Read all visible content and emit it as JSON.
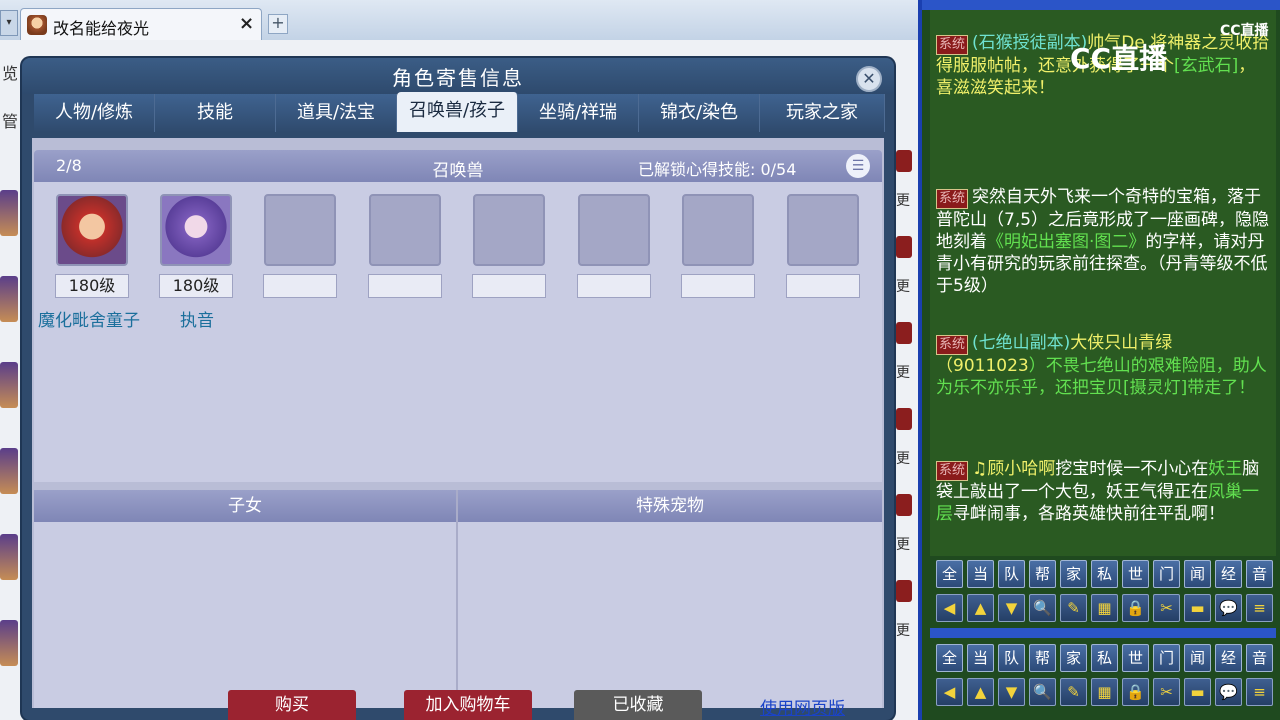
{
  "window": {
    "tab_title": "改名能给夜光",
    "tab_close": "×",
    "tab_add": "+",
    "dropdown": "▾"
  },
  "dialog": {
    "title": "角色寄售信息",
    "close": "✕",
    "tabs": [
      {
        "label": "人物/修炼"
      },
      {
        "label": "技能"
      },
      {
        "label": "道具/法宝"
      },
      {
        "label": "召唤兽/孩子"
      },
      {
        "label": "坐骑/祥瑞"
      },
      {
        "label": "锦衣/染色"
      },
      {
        "label": "玩家之家"
      }
    ],
    "active_tab": "召唤兽/孩子",
    "pets": {
      "count": "2/8",
      "title": "召唤兽",
      "skill_label": "已解锁心得技能: 0/54",
      "slots": [
        {
          "level": "180级",
          "name": "魔化毗舍童子"
        },
        {
          "level": "180级",
          "name": "执音"
        },
        {
          "level": "",
          "name": ""
        },
        {
          "level": "",
          "name": ""
        },
        {
          "level": "",
          "name": ""
        },
        {
          "level": "",
          "name": ""
        },
        {
          "level": "",
          "name": ""
        },
        {
          "level": "",
          "name": ""
        }
      ]
    },
    "children_header": "子女",
    "special_header": "特殊宠物",
    "actions": {
      "buy": "购买",
      "add_cart": "加入购物车",
      "favorited": "已收藏",
      "web_link": "使用网页版"
    },
    "colors": {
      "buy": "#9b2330",
      "cart": "#9b2330",
      "favorited": "#5a5a5a"
    }
  },
  "left_edge": {
    "glyph_1": "览",
    "glyph_2": "管",
    "side_chars": [
      "更",
      "更",
      "更",
      "更",
      "更",
      "更"
    ]
  },
  "chat": {
    "logo": "CC直播",
    "logo_small": "CC直播",
    "messages": [
      {
        "tag": "系统",
        "parts": [
          {
            "text": "(石猴授徒副本)",
            "color": "cyan"
          },
          {
            "text": "帅气De",
            "color": "yellow"
          },
          {
            "text": " 将神器之灵收拾得服服帖帖，还意外获得了一个",
            "color": "yellow"
          },
          {
            "text": "[玄武石]",
            "color": "green"
          },
          {
            "text": "，喜滋滋笑起来！",
            "color": "yellow"
          }
        ]
      },
      {
        "tag": "系统",
        "parts": [
          {
            "text": "突然自天外飞来一个奇特的宝箱，落于普陀山（7,5）之后竟形成了一座画碑，隐隐地刻着",
            "color": "white"
          },
          {
            "text": "《明妃出塞图·图二》",
            "color": "green"
          },
          {
            "text": "的字样，请对丹青小有研究的玩家前往探查。（丹青等级不低于5级）",
            "color": "white"
          }
        ]
      },
      {
        "tag": "系统",
        "parts": [
          {
            "text": "(七绝山副本)",
            "color": "cyan"
          },
          {
            "text": "大侠只山青绿（",
            "color": "yellow"
          },
          {
            "text": "9011023",
            "color": "yellow"
          },
          {
            "text": "）不畏七绝山的艰难险阻，助人为乐不亦乐乎，还把宝贝",
            "color": "green"
          },
          {
            "text": "[摄灵灯]",
            "color": "green"
          },
          {
            "text": "带走了！",
            "color": "green"
          }
        ]
      },
      {
        "tag": "系统",
        "parts": [
          {
            "text": "♫顾小哈啊",
            "color": "yellow"
          },
          {
            "text": "挖宝时候一不小心在",
            "color": "white"
          },
          {
            "text": "妖王",
            "color": "green"
          },
          {
            "text": "脑袋上敲出了一个大包，妖王气得正在",
            "color": "white"
          },
          {
            "text": "凤巢一层",
            "color": "green"
          },
          {
            "text": "寻衅闹事，各路英雄快前往平乱啊！",
            "color": "white"
          }
        ]
      }
    ],
    "channels": [
      "全",
      "当",
      "队",
      "帮",
      "家",
      "私",
      "世",
      "门",
      "闻",
      "经",
      "音"
    ],
    "tools": [
      "arrow-left-icon",
      "arrow-up-icon",
      "arrow-down-icon",
      "magnifier-icon",
      "note-icon",
      "grid-icon",
      "lock-icon",
      "broom-icon",
      "folder-icon",
      "speech-icon",
      "list-icon"
    ],
    "tool_glyphs": [
      "◀",
      "▲",
      "▼",
      "🔍",
      "✎",
      "▦",
      "🔒",
      "✂",
      "▬",
      "💬",
      "≡"
    ]
  }
}
